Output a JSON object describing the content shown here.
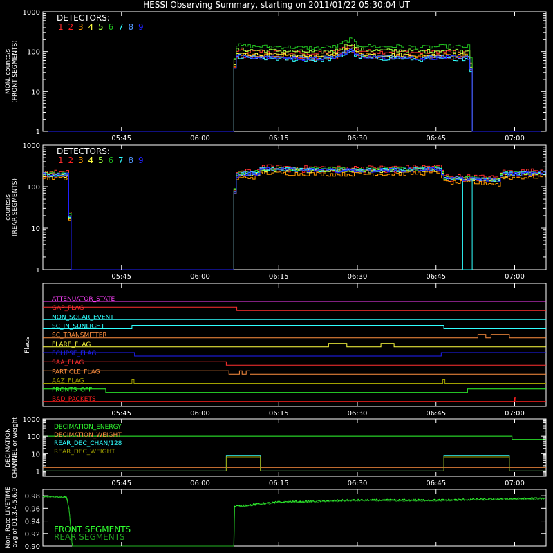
{
  "title": "HESSI Observing Summary, starting on 2011/01/22 05:30:04 UT",
  "detector_colors": [
    "#ff3030",
    "#ff2020",
    "#ff9b00",
    "#ffff40",
    "#a0ff40",
    "#20c020",
    "#30ffff",
    "#5599ff",
    "#2020ff"
  ],
  "x_ticks": [
    "05:45",
    "06:00",
    "06:15",
    "06:30",
    "06:45",
    "07:00"
  ],
  "x_tick_times": [
    15,
    30,
    45,
    60,
    75,
    90
  ],
  "xlim_minutes": [
    0,
    96
  ],
  "chart_data": [
    {
      "type": "line",
      "id": "front",
      "ylabel": [
        "MON. counts/s",
        "(FRONT SEGMENTS)"
      ],
      "ylog": true,
      "ylim": [
        1,
        1000
      ],
      "y_ticks": [
        "1",
        "10",
        "100",
        "1000"
      ],
      "y_tick_values": [
        1,
        10,
        100,
        1000
      ],
      "legend_title": "DETECTORS:",
      "legend_labels": [
        "1",
        "2",
        "3",
        "4",
        "5",
        "6",
        "7",
        "8",
        "9"
      ],
      "series_profile": [
        [
          0,
          1
        ],
        [
          36.4,
          1
        ],
        [
          36.5,
          85
        ],
        [
          40,
          80
        ],
        [
          44,
          78
        ],
        [
          48,
          75
        ],
        [
          52,
          72
        ],
        [
          56,
          80
        ],
        [
          58.5,
          120
        ],
        [
          60,
          85
        ],
        [
          64,
          78
        ],
        [
          68,
          80
        ],
        [
          72,
          75
        ],
        [
          76,
          80
        ],
        [
          80,
          78
        ],
        [
          81.4,
          80
        ],
        [
          81.5,
          1
        ],
        [
          96,
          1
        ]
      ]
    },
    {
      "type": "line",
      "id": "rear",
      "ylabel": [
        "counts/s",
        "(REAR SEGMENTS)"
      ],
      "ylog": true,
      "ylim": [
        1,
        1000
      ],
      "y_ticks": [
        "1",
        "10",
        "100",
        "1000"
      ],
      "y_tick_values": [
        1,
        10,
        100,
        1000
      ],
      "legend_title": "DETECTORS:",
      "legend_labels": [
        "1",
        "2",
        "3",
        "4",
        "5",
        "6",
        "7",
        "8",
        "9"
      ],
      "series_profile": [
        [
          0,
          200
        ],
        [
          4.5,
          195
        ],
        [
          4.6,
          150
        ],
        [
          5.0,
          1
        ],
        [
          36.4,
          1
        ],
        [
          36.5,
          160
        ],
        [
          37,
          200
        ],
        [
          41,
          215
        ],
        [
          41.1,
          270
        ],
        [
          47,
          260
        ],
        [
          56,
          250
        ],
        [
          66,
          255
        ],
        [
          75,
          270
        ],
        [
          76,
          275
        ],
        [
          76.1,
          160
        ],
        [
          85,
          150
        ],
        [
          87,
          140
        ],
        [
          87.1,
          200
        ],
        [
          96,
          220
        ]
      ],
      "cyan_dropout_minutes": [
        79.8,
        81.6
      ]
    },
    {
      "type": "table",
      "id": "flags",
      "ylabel": "Flags",
      "flags": [
        {
          "name": "ATTENUATOR_STATE",
          "color": "#ff40ff",
          "steps": [
            [
              0,
              0
            ],
            [
              96,
              0
            ]
          ]
        },
        {
          "name": "GAP_FLAG",
          "color": "#ff3030",
          "steps": [
            [
              0,
              1
            ],
            [
              37,
              1
            ],
            [
              37,
              0
            ],
            [
              96,
              0
            ]
          ]
        },
        {
          "name": "NON_SOLAR_EVENT",
          "color": "#30ffff",
          "steps": [
            [
              0,
              0
            ],
            [
              96,
              0
            ]
          ]
        },
        {
          "name": "SC_IN_SUNLIGHT",
          "color": "#30ffff",
          "steps": [
            [
              0,
              0
            ],
            [
              17,
              0
            ],
            [
              17,
              1
            ],
            [
              76.5,
              1
            ],
            [
              76.5,
              0
            ],
            [
              96,
              0
            ]
          ]
        },
        {
          "name": "SC_TRANSMITTER",
          "color": "#ff9040",
          "steps": [
            [
              0,
              0
            ],
            [
              83,
              0
            ],
            [
              83,
              1
            ],
            [
              84.5,
              1
            ],
            [
              84.5,
              0
            ],
            [
              85.5,
              0
            ],
            [
              85.5,
              1
            ],
            [
              89,
              1
            ],
            [
              89,
              0
            ],
            [
              96,
              0
            ]
          ]
        },
        {
          "name": "FLARE_FLAG",
          "color": "#ffff40",
          "steps": [
            [
              0,
              0
            ],
            [
              54.5,
              0
            ],
            [
              54.5,
              1
            ],
            [
              58,
              1
            ],
            [
              58,
              0
            ],
            [
              64.5,
              0
            ],
            [
              64.5,
              1
            ],
            [
              67,
              1
            ],
            [
              67,
              0
            ],
            [
              96,
              0
            ]
          ]
        },
        {
          "name": "ECLIPSE_FLAG",
          "color": "#2020ff",
          "steps": [
            [
              0,
              1
            ],
            [
              17.5,
              1
            ],
            [
              17.5,
              0
            ],
            [
              76,
              0
            ],
            [
              76,
              1
            ],
            [
              96,
              1
            ]
          ]
        },
        {
          "name": "SAA_FLAG",
          "color": "#ff3030",
          "steps": [
            [
              0,
              1
            ],
            [
              35,
              1
            ],
            [
              35,
              0
            ],
            [
              96,
              0
            ]
          ]
        },
        {
          "name": "PARTICLE_FLAG",
          "color": "#ff9040",
          "steps": [
            [
              0,
              1
            ],
            [
              35.5,
              1
            ],
            [
              35.5,
              0
            ],
            [
              37.5,
              0
            ],
            [
              37.5,
              1
            ],
            [
              38,
              1
            ],
            [
              38,
              0
            ],
            [
              38.8,
              0
            ],
            [
              38.8,
              1
            ],
            [
              39.5,
              1
            ],
            [
              39.5,
              0
            ],
            [
              96,
              0
            ]
          ]
        },
        {
          "name": "AAZ_FLAG",
          "color": "#a0a000",
          "steps": [
            [
              0,
              0
            ],
            [
              17,
              0
            ],
            [
              17,
              1
            ],
            [
              17.4,
              1
            ],
            [
              17.4,
              0
            ],
            [
              76.3,
              0
            ],
            [
              76.3,
              1
            ],
            [
              76.7,
              1
            ],
            [
              76.7,
              0
            ],
            [
              96,
              0
            ]
          ]
        },
        {
          "name": "FRONTS_OFF",
          "color": "#30ff30",
          "steps": [
            [
              0,
              1
            ],
            [
              12,
              1
            ],
            [
              12,
              0
            ],
            [
              81,
              0
            ],
            [
              81,
              1
            ],
            [
              96,
              1
            ]
          ]
        },
        {
          "name": "BAD_PACKETS",
          "color": "#ff2020",
          "steps": [
            [
              0,
              0
            ],
            [
              90,
              0
            ],
            [
              90,
              1
            ],
            [
              90.2,
              1
            ],
            [
              90.2,
              0
            ],
            [
              96,
              0
            ]
          ]
        }
      ]
    },
    {
      "type": "line",
      "id": "decimation",
      "ylabel": [
        "DECIMATION",
        "CHANNEL or weight"
      ],
      "ylog": true,
      "ylim": [
        0.5,
        1000
      ],
      "y_ticks": [
        "1",
        "10",
        "100",
        "1000"
      ],
      "y_tick_values": [
        1,
        10,
        100,
        1000
      ],
      "series": [
        {
          "name": "DECIMATION_ENERGY",
          "color": "#30ff30",
          "points": [
            [
              0,
              100
            ],
            [
              89.5,
              100
            ],
            [
              89.5,
              65
            ],
            [
              96,
              65
            ]
          ]
        },
        {
          "name": "DECIMATION_WEIGHT",
          "color": "#ff9040",
          "points": [
            [
              0,
              1.6
            ],
            [
              96,
              1.6
            ]
          ]
        },
        {
          "name": "REAR_DEC_CHAN/128",
          "color": "#30ffff",
          "points": [
            [
              0,
              1
            ],
            [
              35,
              1
            ],
            [
              35,
              8
            ],
            [
              41.5,
              8
            ],
            [
              41.5,
              1
            ],
            [
              76.5,
              1
            ],
            [
              76.5,
              8
            ],
            [
              89,
              8
            ],
            [
              89,
              1
            ],
            [
              96,
              1
            ]
          ]
        },
        {
          "name": "REAR_DEC_WEIGHT",
          "color": "#a0a000",
          "points": [
            [
              0,
              1
            ],
            [
              35,
              1
            ],
            [
              35,
              6.5
            ],
            [
              41.5,
              6.5
            ],
            [
              41.5,
              1
            ],
            [
              76.5,
              1
            ],
            [
              76.5,
              6.5
            ],
            [
              89,
              6.5
            ],
            [
              89,
              1
            ],
            [
              96,
              1
            ]
          ]
        }
      ]
    },
    {
      "type": "line",
      "id": "livetime",
      "ylabel": [
        "Mon. Rate LIVETIME",
        "avg of D1,3,4,5,6,9"
      ],
      "ylog": false,
      "ylim": [
        0.9,
        0.99
      ],
      "y_ticks": [
        "0.90",
        "0.92",
        "0.94",
        "0.96",
        "0.98"
      ],
      "y_tick_values": [
        0.9,
        0.92,
        0.94,
        0.96,
        0.98
      ],
      "series": [
        {
          "name": "FRONT SEGMENTS",
          "color": "#30ff30"
        },
        {
          "name": "REAR SEGMENTS",
          "color": "#20a020"
        }
      ],
      "front_profile": [
        [
          0,
          0.979
        ],
        [
          4.5,
          0.978
        ],
        [
          5,
          0.96
        ],
        [
          5.6,
          0.9
        ],
        [
          36.5,
          0.9
        ],
        [
          36.6,
          0.963
        ],
        [
          45,
          0.97
        ],
        [
          60,
          0.973
        ],
        [
          75,
          0.973
        ],
        [
          96,
          0.976
        ]
      ]
    }
  ]
}
